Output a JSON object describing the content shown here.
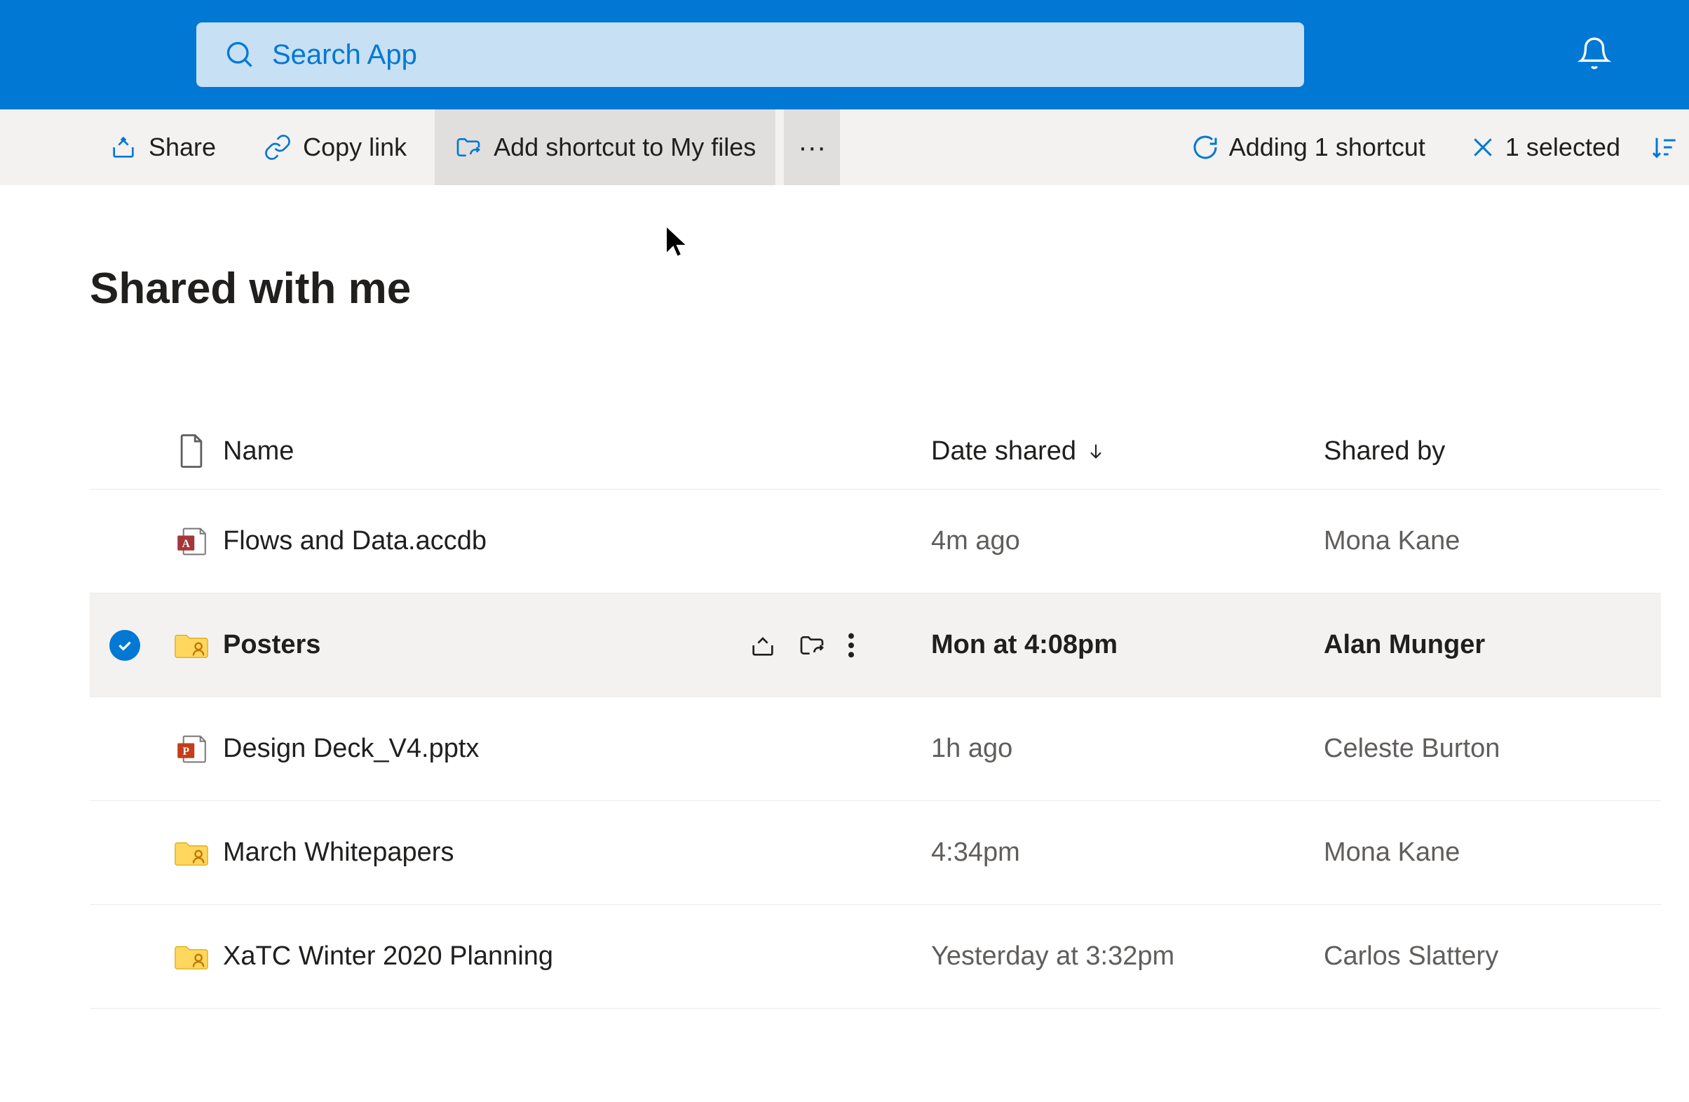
{
  "search": {
    "placeholder": "Search App"
  },
  "toolbar": {
    "share_label": "Share",
    "copy_link_label": "Copy link",
    "add_shortcut_label": "Add shortcut to My files",
    "more": "···",
    "status_label": "Adding 1 shortcut",
    "selected_label": "1 selected"
  },
  "page": {
    "title": "Shared with me"
  },
  "columns": {
    "name": "Name",
    "date_shared": "Date shared",
    "shared_by": "Shared by"
  },
  "rows": [
    {
      "icon": "access",
      "name": "Flows and Data.accdb",
      "date": "4m ago",
      "shared_by": "Mona Kane",
      "selected": false
    },
    {
      "icon": "shared-folder",
      "name": "Posters",
      "date": "Mon at 4:08pm",
      "shared_by": "Alan Munger",
      "selected": true
    },
    {
      "icon": "powerpoint",
      "name": "Design Deck_V4.pptx",
      "date": "1h ago",
      "shared_by": "Celeste Burton",
      "selected": false
    },
    {
      "icon": "shared-folder",
      "name": "March Whitepapers",
      "date": "4:34pm",
      "shared_by": "Mona Kane",
      "selected": false
    },
    {
      "icon": "shared-folder",
      "name": "XaTC Winter 2020 Planning",
      "date": "Yesterday at 3:32pm",
      "shared_by": "Carlos Slattery",
      "selected": false
    }
  ],
  "icons": {
    "share": "share-icon",
    "link": "link-icon",
    "folder_shortcut": "folder-shortcut-icon",
    "refresh": "refresh-icon",
    "close": "close-icon",
    "sort": "sort-icon",
    "search": "search-icon",
    "bell": "bell-icon",
    "arrow_down": "arrow-down-icon"
  },
  "colors": {
    "primary": "#0078d4",
    "search_bg": "#c7e0f4",
    "command_bg": "#f3f2f1",
    "command_hover": "#e1dfdd"
  }
}
